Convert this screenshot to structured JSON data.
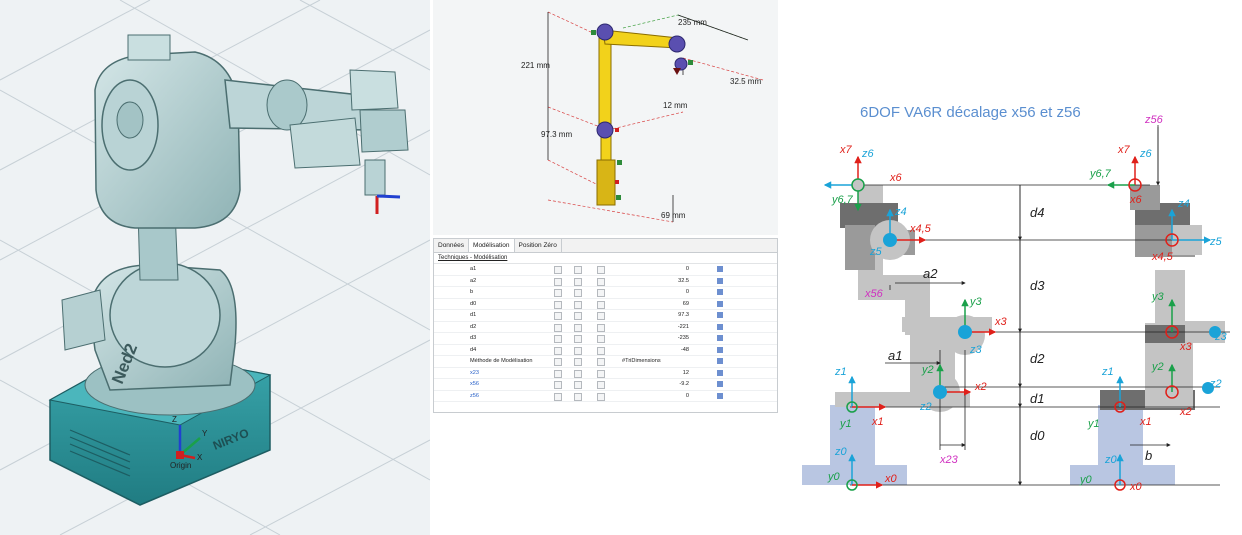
{
  "cad_view": {
    "robot_label": "Ned2",
    "brand_label": "NIRYO",
    "frame_label": "Origin",
    "axis_labels": {
      "x": "X",
      "y": "Y",
      "z": "Z"
    }
  },
  "schematic": {
    "dims": [
      "235 mm",
      "221 mm",
      "32.5 mm",
      "12 mm",
      "97.3 mm",
      "69 mm"
    ]
  },
  "param_panel": {
    "tabs": [
      {
        "label": "Données",
        "active": false
      },
      {
        "label": "Modélisation",
        "active": true
      },
      {
        "label": "Position Zéro",
        "active": false
      }
    ],
    "section_label": "Techniques - Modélisation",
    "rows": [
      {
        "name": "a1",
        "value": "0",
        "style": "plain"
      },
      {
        "name": "a2",
        "value": "32.5",
        "style": "plain"
      },
      {
        "name": "b",
        "value": "0",
        "style": "plain"
      },
      {
        "name": "d0",
        "value": "69",
        "style": "plain"
      },
      {
        "name": "d1",
        "value": "97.3",
        "style": "plain"
      },
      {
        "name": "d2",
        "value": "-221",
        "style": "plain"
      },
      {
        "name": "d3",
        "value": "-235",
        "style": "plain"
      },
      {
        "name": "d4",
        "value": "-48",
        "style": "plain"
      },
      {
        "name": "Méthode de Modélisation",
        "value": "#TriDimensions",
        "style": "dropdown"
      },
      {
        "name": "x23",
        "value": "12",
        "style": "blue"
      },
      {
        "name": "x56",
        "value": "-9.2",
        "style": "blue"
      },
      {
        "name": "z56",
        "value": "0",
        "style": "blue"
      }
    ]
  },
  "kinematic_diagram": {
    "title": "6DOF VA6R décalage x56 et z56",
    "dims": {
      "d0": "d0",
      "d1": "d1",
      "d2": "d2",
      "d3": "d3",
      "d4": "d4",
      "a1": "a1",
      "a2": "a2",
      "b": "b",
      "x23": "x23",
      "x56": "x56",
      "z56": "z56"
    },
    "left_labels": [
      "x7",
      "z6",
      "x6",
      "y6,7",
      "z4",
      "x4,5",
      "z5",
      "y3",
      "x3",
      "z3",
      "z1",
      "y2",
      "x2",
      "z2",
      "y1",
      "x1",
      "z0",
      "y0",
      "x0"
    ],
    "right_labels": [
      "x7",
      "z6",
      "y6,7",
      "x6",
      "z4",
      "z5",
      "x4,5",
      "y3",
      "z3",
      "x3",
      "z1",
      "y2",
      "z2",
      "x2",
      "y1",
      "x1",
      "z0",
      "y0",
      "x0"
    ],
    "colors": {
      "red": "#e0201a",
      "green": "#1aa04a",
      "cyan": "#1aa3d8",
      "magenta": "#d030c0",
      "title": "#5b8fd0",
      "dark": "#6e6e6e",
      "mid": "#9a9a9a",
      "light": "#c4c4c4",
      "base": "#b9c6e2"
    }
  }
}
